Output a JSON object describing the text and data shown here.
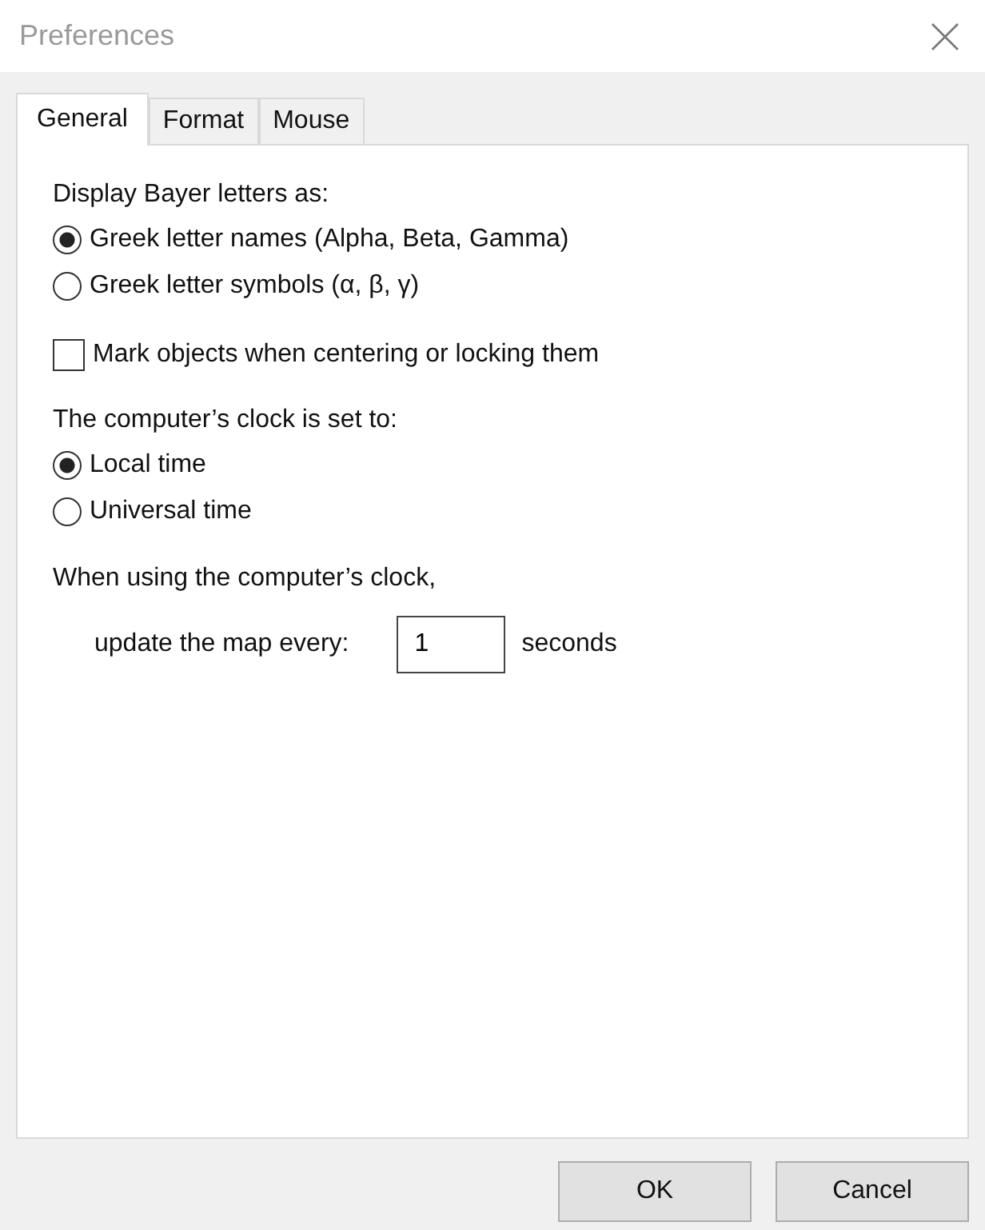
{
  "window": {
    "title": "Preferences"
  },
  "tabs": [
    {
      "label": "General",
      "selected": true
    },
    {
      "label": "Format",
      "selected": false
    },
    {
      "label": "Mouse",
      "selected": false
    }
  ],
  "bayer": {
    "label": "Display Bayer letters as:",
    "options": [
      {
        "label": "Greek letter names (Alpha, Beta, Gamma)",
        "selected": true
      },
      {
        "label": "Greek letter symbols (α, β, γ)",
        "selected": false
      }
    ]
  },
  "mark_objects": {
    "label": "Mark objects when centering or locking them",
    "checked": false
  },
  "clock": {
    "label": "The computer’s clock is set to:",
    "options": [
      {
        "label": "Local time",
        "selected": true
      },
      {
        "label": "Universal time",
        "selected": false
      }
    ]
  },
  "update": {
    "label": "When using the computer’s clock,",
    "field_label": "update the map every:",
    "value": "1",
    "unit": "seconds"
  },
  "buttons": [
    "OK",
    "Cancel"
  ]
}
